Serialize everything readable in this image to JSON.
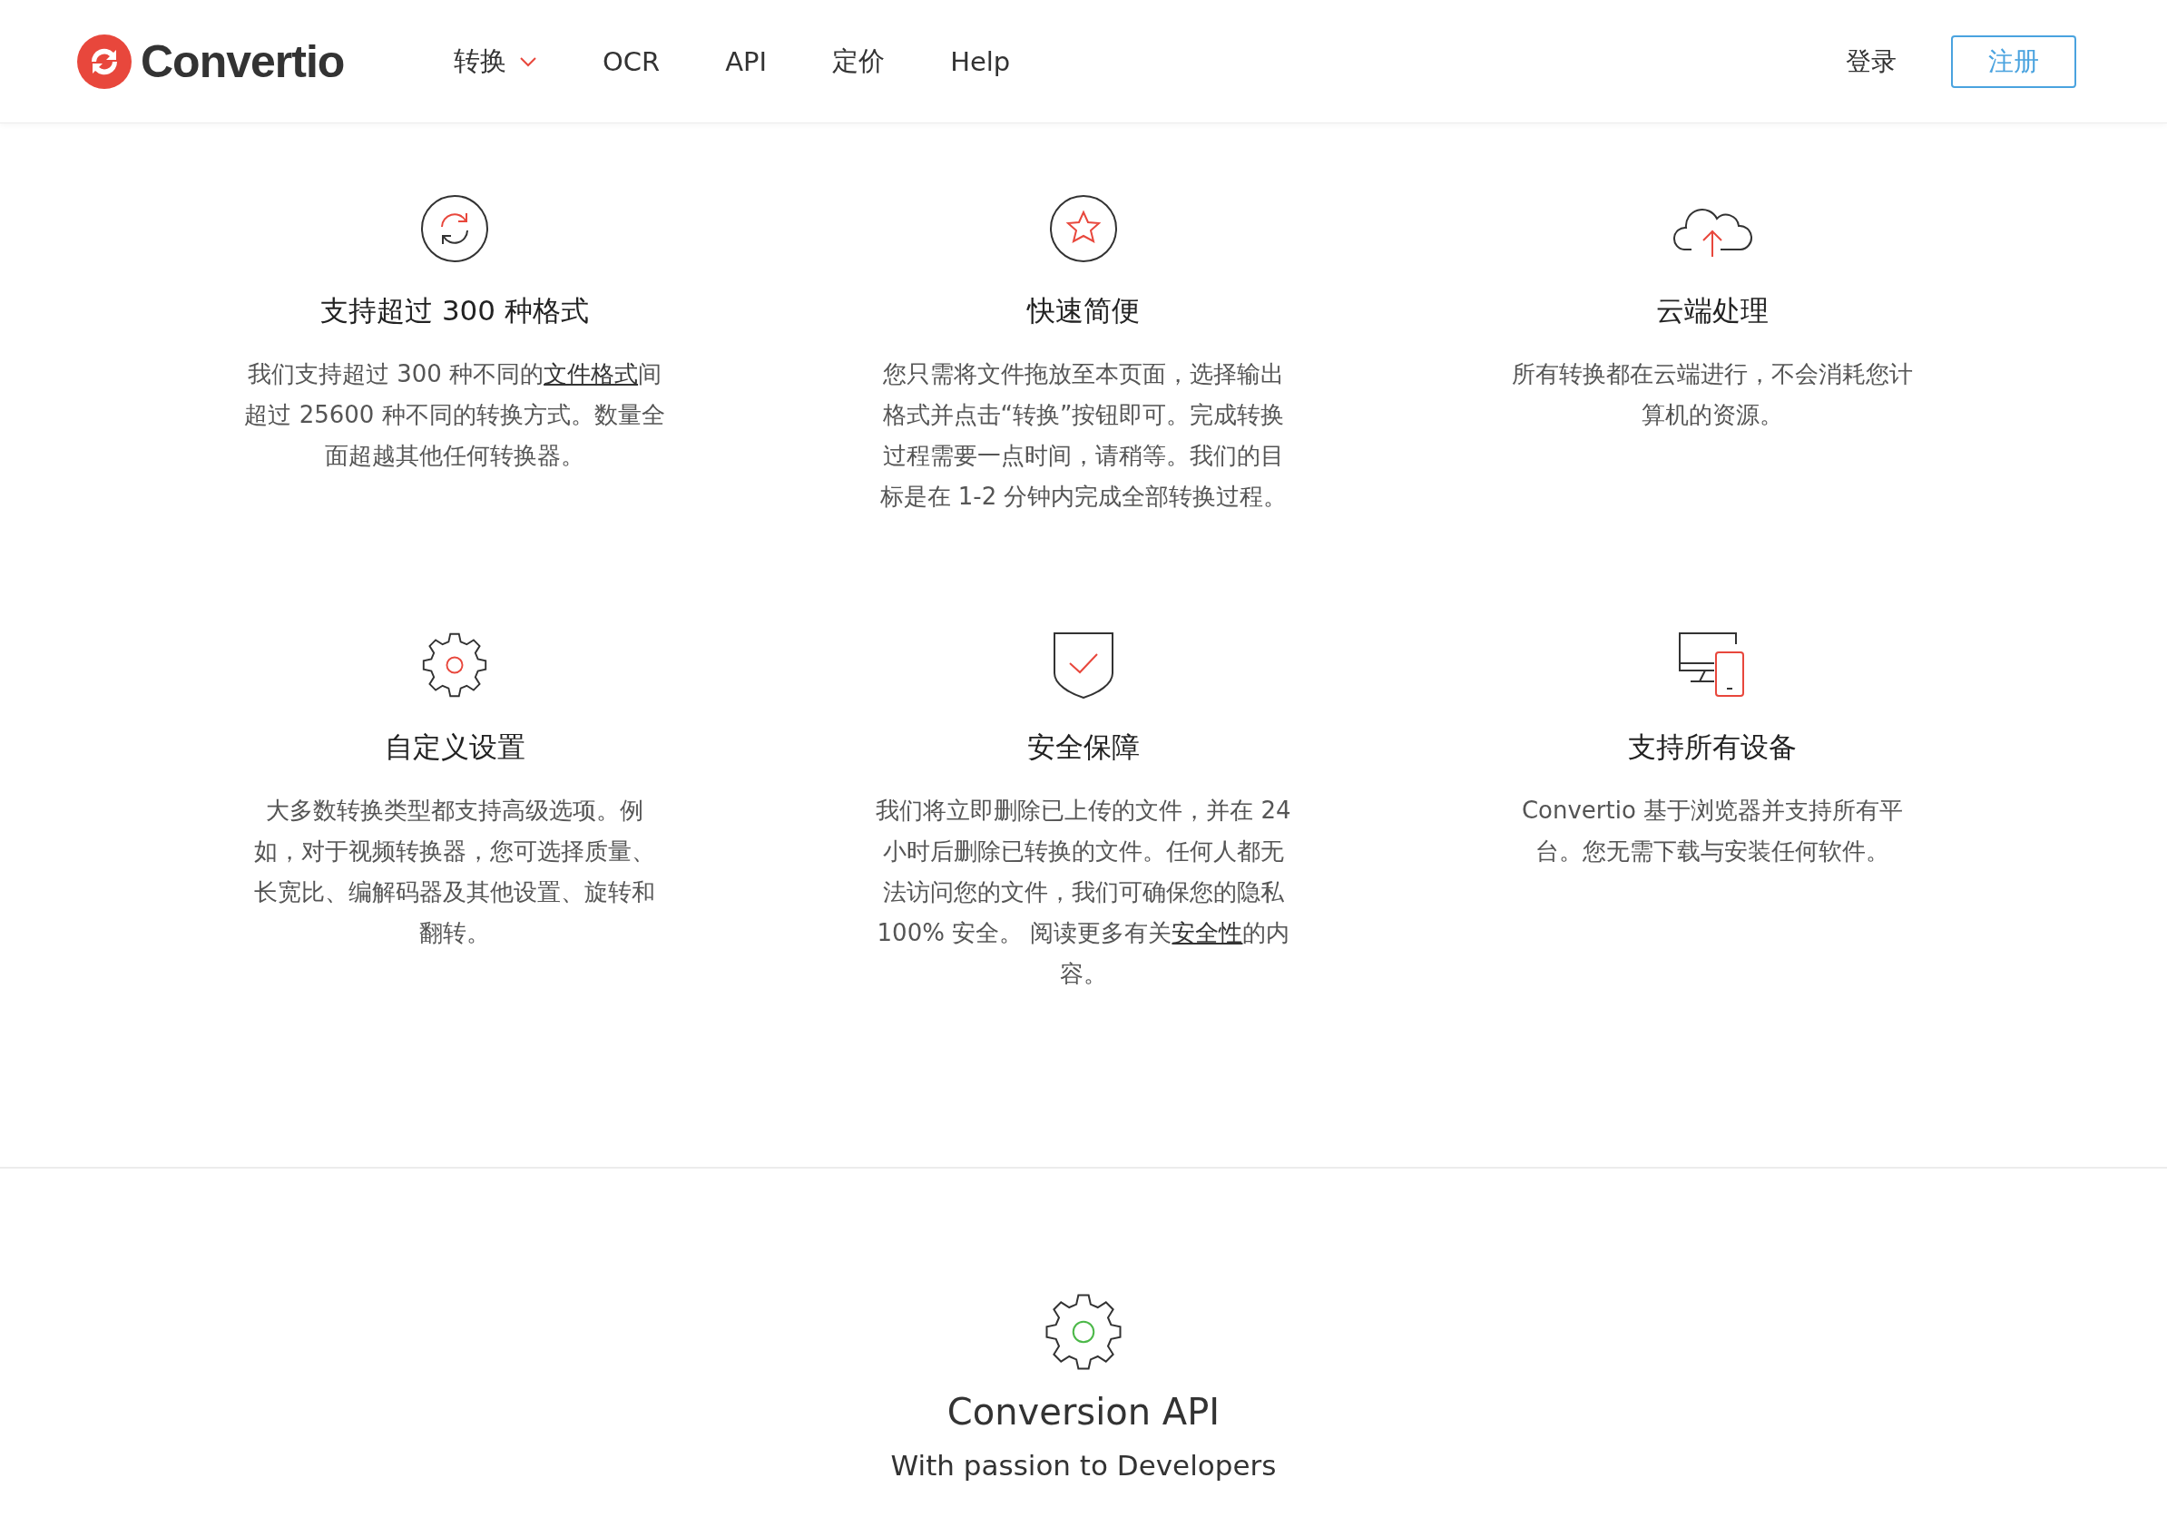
{
  "header": {
    "logo": "Convertio",
    "nav": [
      {
        "label": "转换",
        "dropdown": true
      },
      {
        "label": "OCR",
        "dropdown": false
      },
      {
        "label": "API",
        "dropdown": false
      },
      {
        "label": "定价",
        "dropdown": false
      },
      {
        "label": "Help",
        "dropdown": false
      }
    ],
    "login": "登录",
    "signup": "注册"
  },
  "features": [
    {
      "title": "支持超过 300 种格式",
      "parts": [
        {
          "kind": "text",
          "text": "我们支持超过 300 种不同的"
        },
        {
          "kind": "link",
          "text": "文件格式"
        },
        {
          "kind": "text",
          "text": "间超过 25600 种不同的转换方式。数量全面超越其他任何转换器。"
        }
      ]
    },
    {
      "title": "快速简便",
      "parts": [
        {
          "kind": "text",
          "text": "您只需将文件拖放至本页面，选择输出格式并点击“转换”按钮即可。完成转换过程需要一点时间，请稍等。我们的目标是在 1-2 分钟内完成全部转换过程。"
        }
      ]
    },
    {
      "title": "云端处理",
      "parts": [
        {
          "kind": "text",
          "text": "所有转换都在云端进行，不会消耗您计算机的资源。"
        }
      ]
    },
    {
      "title": "自定义设置",
      "parts": [
        {
          "kind": "text",
          "text": "大多数转换类型都支持高级选项。例如，对于视频转换器，您可选择质量、长宽比、编解码器及其他设置、旋转和翻转。"
        }
      ]
    },
    {
      "title": "安全保障",
      "parts": [
        {
          "kind": "text",
          "text": "我们将立即删除已上传的文件，并在 24 小时后删除已转换的文件。任何人都无法访问您的文件，我们可确保您的隐私 100% 安全。 阅读更多有关"
        },
        {
          "kind": "link",
          "text": "安全性"
        },
        {
          "kind": "text",
          "text": "的内容。"
        }
      ]
    },
    {
      "title": "支持所有设备",
      "parts": [
        {
          "kind": "text",
          "text": "Convertio 基于浏览器并支持所有平台。您无需下载与安装任何软件。"
        }
      ]
    }
  ],
  "api": {
    "title": "Conversion API",
    "subtitle": "With passion to Developers"
  }
}
